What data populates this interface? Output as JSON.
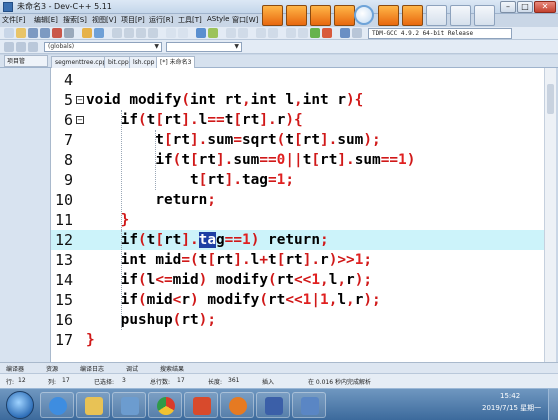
{
  "window": {
    "title": "未命名3 - Dev-C++ 5.11"
  },
  "menu": [
    "文件[F]",
    "编辑[E]",
    "搜索[S]",
    "视图[V]",
    "项目[P]",
    "运行[R]",
    "工具[T]",
    "AStyle",
    "窗口[W]"
  ],
  "toolbar": {
    "compiler": "TDM-GCC 4.9.2 64-bit Release",
    "scope": "(globals)"
  },
  "tabs": {
    "project_panel": "项目管",
    "files": [
      "segmenttree.cpp",
      "bit.cpp",
      "lsh.cpp",
      "[*] 未命名3"
    ]
  },
  "editor": {
    "lines": [
      {
        "num": "4",
        "code": ""
      },
      {
        "num": "5",
        "code": "void modify(int rt,int l,int r){"
      },
      {
        "num": "6",
        "code": "    if(t[rt].l==t[rt].r){"
      },
      {
        "num": "7",
        "code": "        t[rt].sum=sqrt(t[rt].sum);"
      },
      {
        "num": "8",
        "code": "        if(t[rt].sum==0||t[rt].sum==1)"
      },
      {
        "num": "9",
        "code": "            t[rt].tag=1;"
      },
      {
        "num": "10",
        "code": "        return;"
      },
      {
        "num": "11",
        "code": "    }"
      },
      {
        "num": "12",
        "code": "    if(t[rt].tag==1) return;"
      },
      {
        "num": "13",
        "code": "    int mid=(t[rt].l+t[rt].r)>>1;"
      },
      {
        "num": "14",
        "code": "    if(l<=mid) modify(rt<<1,l,r);"
      },
      {
        "num": "15",
        "code": "    if(mid<r) modify(rt<<1|1,l,r);"
      },
      {
        "num": "16",
        "code": "    pushup(rt);"
      },
      {
        "num": "17",
        "code": "}"
      }
    ],
    "current_line": "12",
    "selected_text": "ta"
  },
  "bottom_tabs": [
    "编译器",
    "资源",
    "编译日志",
    "调试",
    "搜索结果"
  ],
  "status": {
    "row_label": "行:",
    "row": "12",
    "col_label": "列:",
    "col": "17",
    "sel_label": "已选择:",
    "sel": "3",
    "total_label": "总行数:",
    "total": "17",
    "len_label": "长度:",
    "len": "361",
    "mode": "插入",
    "parse": "在 0.016 秒内完成解析"
  },
  "taskbar": {
    "time": "15:42",
    "date": "2019/7/15 星期一"
  },
  "colors": {
    "keyword": "#000000",
    "symbol": "#d01818",
    "number": "#e02020",
    "current_line": "#ccf3fa",
    "selection": "#1c3fa3"
  }
}
